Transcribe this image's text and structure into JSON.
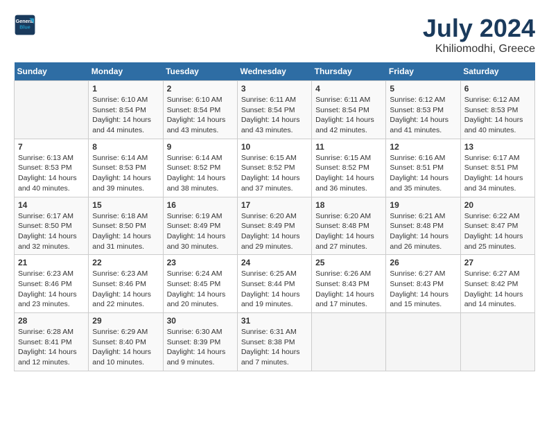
{
  "header": {
    "logo_line1": "General",
    "logo_line2": "Blue",
    "title": "July 2024",
    "subtitle": "Khiliomodhi, Greece"
  },
  "days_of_week": [
    "Sunday",
    "Monday",
    "Tuesday",
    "Wednesday",
    "Thursday",
    "Friday",
    "Saturday"
  ],
  "weeks": [
    [
      {
        "num": "",
        "info": ""
      },
      {
        "num": "1",
        "info": "Sunrise: 6:10 AM\nSunset: 8:54 PM\nDaylight: 14 hours\nand 44 minutes."
      },
      {
        "num": "2",
        "info": "Sunrise: 6:10 AM\nSunset: 8:54 PM\nDaylight: 14 hours\nand 43 minutes."
      },
      {
        "num": "3",
        "info": "Sunrise: 6:11 AM\nSunset: 8:54 PM\nDaylight: 14 hours\nand 43 minutes."
      },
      {
        "num": "4",
        "info": "Sunrise: 6:11 AM\nSunset: 8:54 PM\nDaylight: 14 hours\nand 42 minutes."
      },
      {
        "num": "5",
        "info": "Sunrise: 6:12 AM\nSunset: 8:53 PM\nDaylight: 14 hours\nand 41 minutes."
      },
      {
        "num": "6",
        "info": "Sunrise: 6:12 AM\nSunset: 8:53 PM\nDaylight: 14 hours\nand 40 minutes."
      }
    ],
    [
      {
        "num": "7",
        "info": "Sunrise: 6:13 AM\nSunset: 8:53 PM\nDaylight: 14 hours\nand 40 minutes."
      },
      {
        "num": "8",
        "info": "Sunrise: 6:14 AM\nSunset: 8:53 PM\nDaylight: 14 hours\nand 39 minutes."
      },
      {
        "num": "9",
        "info": "Sunrise: 6:14 AM\nSunset: 8:52 PM\nDaylight: 14 hours\nand 38 minutes."
      },
      {
        "num": "10",
        "info": "Sunrise: 6:15 AM\nSunset: 8:52 PM\nDaylight: 14 hours\nand 37 minutes."
      },
      {
        "num": "11",
        "info": "Sunrise: 6:15 AM\nSunset: 8:52 PM\nDaylight: 14 hours\nand 36 minutes."
      },
      {
        "num": "12",
        "info": "Sunrise: 6:16 AM\nSunset: 8:51 PM\nDaylight: 14 hours\nand 35 minutes."
      },
      {
        "num": "13",
        "info": "Sunrise: 6:17 AM\nSunset: 8:51 PM\nDaylight: 14 hours\nand 34 minutes."
      }
    ],
    [
      {
        "num": "14",
        "info": "Sunrise: 6:17 AM\nSunset: 8:50 PM\nDaylight: 14 hours\nand 32 minutes."
      },
      {
        "num": "15",
        "info": "Sunrise: 6:18 AM\nSunset: 8:50 PM\nDaylight: 14 hours\nand 31 minutes."
      },
      {
        "num": "16",
        "info": "Sunrise: 6:19 AM\nSunset: 8:49 PM\nDaylight: 14 hours\nand 30 minutes."
      },
      {
        "num": "17",
        "info": "Sunrise: 6:20 AM\nSunset: 8:49 PM\nDaylight: 14 hours\nand 29 minutes."
      },
      {
        "num": "18",
        "info": "Sunrise: 6:20 AM\nSunset: 8:48 PM\nDaylight: 14 hours\nand 27 minutes."
      },
      {
        "num": "19",
        "info": "Sunrise: 6:21 AM\nSunset: 8:48 PM\nDaylight: 14 hours\nand 26 minutes."
      },
      {
        "num": "20",
        "info": "Sunrise: 6:22 AM\nSunset: 8:47 PM\nDaylight: 14 hours\nand 25 minutes."
      }
    ],
    [
      {
        "num": "21",
        "info": "Sunrise: 6:23 AM\nSunset: 8:46 PM\nDaylight: 14 hours\nand 23 minutes."
      },
      {
        "num": "22",
        "info": "Sunrise: 6:23 AM\nSunset: 8:46 PM\nDaylight: 14 hours\nand 22 minutes."
      },
      {
        "num": "23",
        "info": "Sunrise: 6:24 AM\nSunset: 8:45 PM\nDaylight: 14 hours\nand 20 minutes."
      },
      {
        "num": "24",
        "info": "Sunrise: 6:25 AM\nSunset: 8:44 PM\nDaylight: 14 hours\nand 19 minutes."
      },
      {
        "num": "25",
        "info": "Sunrise: 6:26 AM\nSunset: 8:43 PM\nDaylight: 14 hours\nand 17 minutes."
      },
      {
        "num": "26",
        "info": "Sunrise: 6:27 AM\nSunset: 8:43 PM\nDaylight: 14 hours\nand 15 minutes."
      },
      {
        "num": "27",
        "info": "Sunrise: 6:27 AM\nSunset: 8:42 PM\nDaylight: 14 hours\nand 14 minutes."
      }
    ],
    [
      {
        "num": "28",
        "info": "Sunrise: 6:28 AM\nSunset: 8:41 PM\nDaylight: 14 hours\nand 12 minutes."
      },
      {
        "num": "29",
        "info": "Sunrise: 6:29 AM\nSunset: 8:40 PM\nDaylight: 14 hours\nand 10 minutes."
      },
      {
        "num": "30",
        "info": "Sunrise: 6:30 AM\nSunset: 8:39 PM\nDaylight: 14 hours\nand 9 minutes."
      },
      {
        "num": "31",
        "info": "Sunrise: 6:31 AM\nSunset: 8:38 PM\nDaylight: 14 hours\nand 7 minutes."
      },
      {
        "num": "",
        "info": ""
      },
      {
        "num": "",
        "info": ""
      },
      {
        "num": "",
        "info": ""
      }
    ]
  ]
}
